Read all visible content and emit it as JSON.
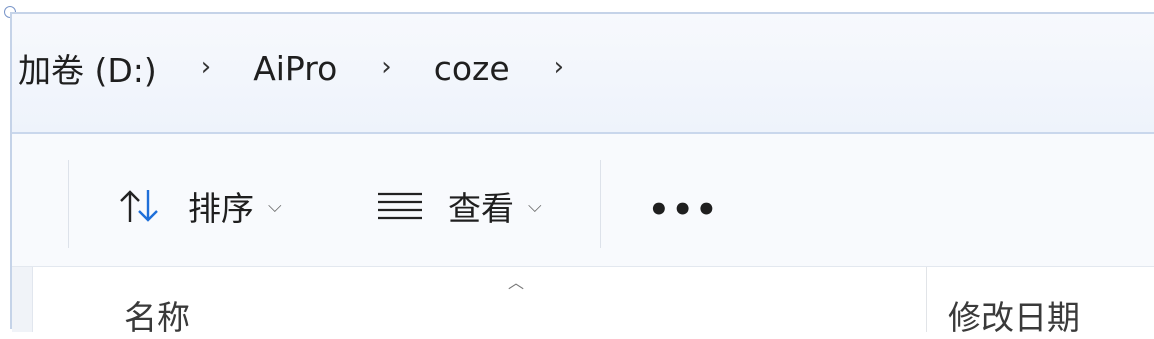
{
  "breadcrumb": {
    "items": [
      {
        "label": "卷 (D:)",
        "display": "卷 (D:)"
      },
      {
        "label": "AiPro"
      },
      {
        "label": "coze"
      }
    ],
    "partial_prefix": "加",
    "separator_glyph": "›"
  },
  "toolbar": {
    "sort_label": "排序",
    "view_label": "查看",
    "more_label": "•••",
    "dropdown_glyph": "⌵"
  },
  "columns": {
    "sort_indicator": "︿",
    "name_header": "名称",
    "date_header": "修改日期"
  },
  "icons": {
    "sort": "sort-arrows-icon",
    "view": "view-lines-icon",
    "more": "more-icon"
  },
  "colors": {
    "accent_blue": "#1e6fd9",
    "frame_border": "#c5d3e8"
  }
}
